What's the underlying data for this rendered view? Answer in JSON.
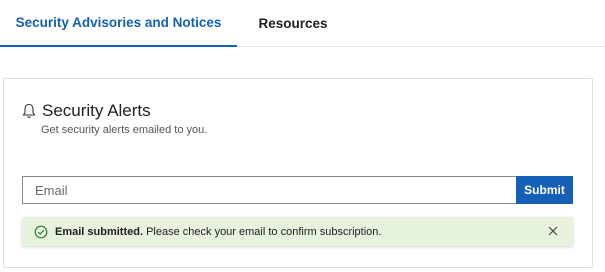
{
  "tabs": [
    {
      "label": "Security Advisories and Notices",
      "active": true
    },
    {
      "label": "Resources",
      "active": false
    }
  ],
  "card": {
    "title": "Security Alerts",
    "subtitle": "Get security alerts emailed to you.",
    "icon": "bell-icon"
  },
  "form": {
    "email_placeholder": "Email",
    "email_value": "",
    "submit_label": "Submit"
  },
  "alert": {
    "strong_text": "Email submitted.",
    "message": " Please check your email to confirm subscription.",
    "status_icon": "check-circle-icon",
    "close_icon": "close-icon"
  },
  "colors": {
    "accent": "#1660b8",
    "success_bg": "#e6f2dc",
    "success_icon": "#2e7d32"
  }
}
